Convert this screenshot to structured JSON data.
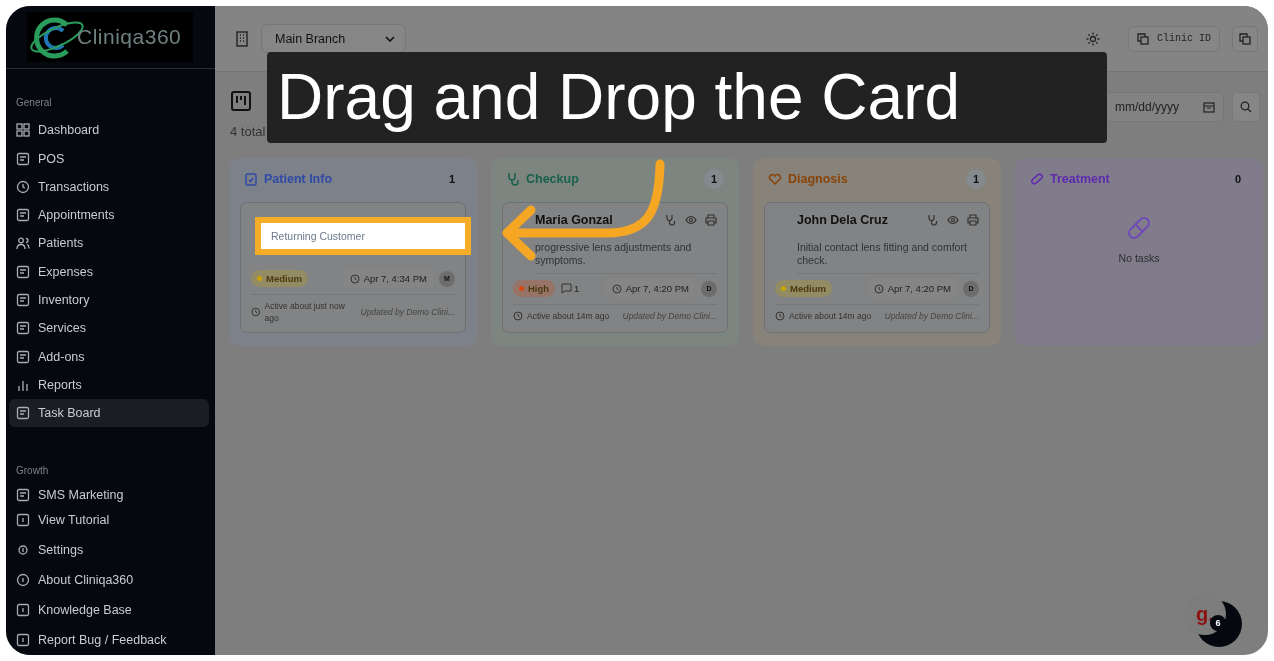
{
  "sidebar": {
    "logo": "Cliniqa360",
    "sections": [
      {
        "title": "General",
        "items": [
          {
            "label": "Dashboard",
            "selected": false
          },
          {
            "label": "POS",
            "selected": false
          },
          {
            "label": "Transactions",
            "selected": false
          },
          {
            "label": "Appointments",
            "selected": false
          },
          {
            "label": "Patients",
            "selected": false
          },
          {
            "label": "Expenses",
            "selected": false
          },
          {
            "label": "Inventory",
            "selected": false
          },
          {
            "label": "Services",
            "selected": false
          },
          {
            "label": "Add-ons",
            "selected": false
          },
          {
            "label": "Reports",
            "selected": false
          },
          {
            "label": "Task Board",
            "selected": true
          }
        ]
      },
      {
        "title": "Growth",
        "items": [
          {
            "label": "SMS Marketing",
            "selected": false
          }
        ]
      }
    ],
    "footer_items": [
      "View Tutorial",
      "Settings",
      "About Cliniqa360",
      "Knowledge Base",
      "Report Bug / Feedback"
    ]
  },
  "topbar": {
    "branch": "Main Branch",
    "clinic_id_button": "Clinic ID"
  },
  "page": {
    "subtitle": "4 total",
    "date_placeholder": "mm/dd/yyyy"
  },
  "columns": [
    {
      "title": "Patient Info",
      "count": "1",
      "color": "#2f4aa8",
      "cards": [
        {
          "highlight": "Returning Customer",
          "priority": {
            "label": "Medium",
            "color": "#c9a300"
          },
          "time": "Apr 7, 4:34 PM",
          "avatar": "M",
          "activity": "Active about just now ago",
          "updated": "Updated by Demo Clini..."
        }
      ]
    },
    {
      "title": "Checkup",
      "count": "1",
      "color": "#1a6149",
      "cards": [
        {
          "name": "Maria Gonzal",
          "description": "progressive lens adjustments and symptoms.",
          "priority": {
            "label": "High",
            "color": "#d9480f"
          },
          "comments": "1",
          "time": "Apr 7, 4:20 PM",
          "avatar": "D",
          "activity": "Active about 14m ago",
          "updated": "Updated by Demo Clini..."
        }
      ]
    },
    {
      "title": "Diagnosis",
      "count": "1",
      "color": "#8a4408",
      "cards": [
        {
          "name": "John Dela Cruz",
          "description": "Initial contact lens fitting and comfort check.",
          "priority": {
            "label": "Medium",
            "color": "#c9a300"
          },
          "time": "Apr 7, 4:20 PM",
          "avatar": "D",
          "activity": "Active about 14m ago",
          "updated": "Updated by Demo Clini..."
        }
      ]
    },
    {
      "title": "Treatment",
      "count": "0",
      "color": "#5e2aae",
      "empty_text": "No tasks"
    }
  ],
  "tutorial": {
    "banner": "Drag and Drop the Card"
  },
  "help_widget": {
    "logo": "g.",
    "badge": "6"
  }
}
